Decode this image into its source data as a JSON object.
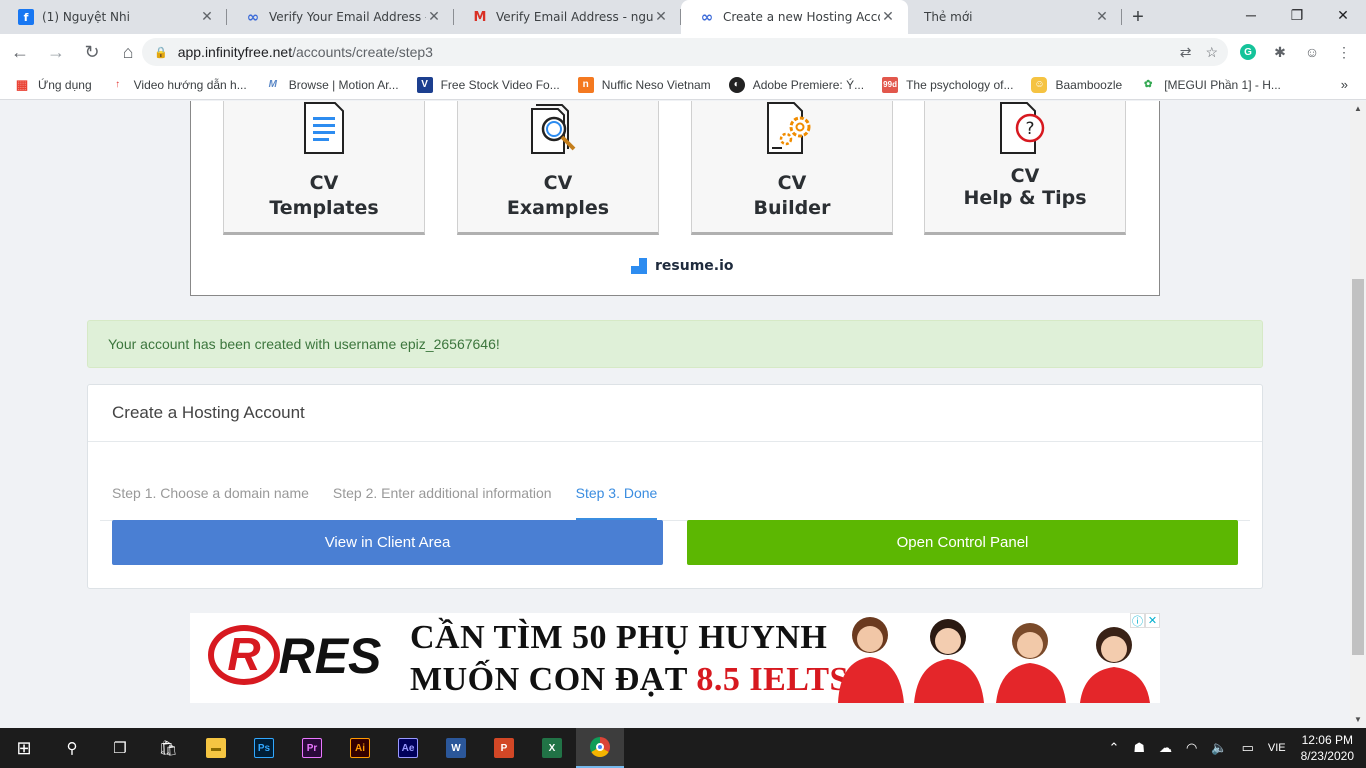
{
  "browser": {
    "tabs": [
      {
        "title": "(1) Nguyệt Nhi",
        "icon": "facebook-icon",
        "active": false
      },
      {
        "title": "Verify Your Email Address - Infi",
        "icon": "infinityfree-icon",
        "active": false
      },
      {
        "title": "Verify Email Address - nguyenn",
        "icon": "gmail-icon",
        "active": false
      },
      {
        "title": "Create a new Hosting Account",
        "icon": "infinityfree-icon",
        "active": true
      },
      {
        "title": "Thẻ mới",
        "icon": "",
        "active": false
      }
    ],
    "address": {
      "host": "app.infinityfree.net",
      "path": "/accounts/create/step3"
    },
    "bookmarks": [
      {
        "label": "Ứng dụng",
        "icon": "apps-grid-icon"
      },
      {
        "label": "Video hướng dẫn h...",
        "icon": "video-icon"
      },
      {
        "label": "Browse | Motion Ar...",
        "icon": "motion-array-icon"
      },
      {
        "label": "Free Stock Video Fo...",
        "icon": "videvo-icon"
      },
      {
        "label": "Nuffic Neso Vietnam",
        "icon": "nuffic-icon"
      },
      {
        "label": "Adobe Premiere: Ý...",
        "icon": "premiere-icon"
      },
      {
        "label": "The psychology of...",
        "icon": "99designs-icon"
      },
      {
        "label": "Baamboozle",
        "icon": "baamboozle-icon"
      },
      {
        "label": "[MEGUI Phần 1] - H...",
        "icon": "megui-icon"
      }
    ]
  },
  "ad_top": {
    "cards": [
      {
        "line1": "CV",
        "line2": "Templates",
        "icon": "document-icon"
      },
      {
        "line1": "CV",
        "line2": "Examples",
        "icon": "magnifier-document-icon"
      },
      {
        "line1": "CV",
        "line2": "Builder",
        "icon": "gear-document-icon"
      },
      {
        "line1": "CV",
        "line2": "Help & Tips",
        "icon": "question-document-icon"
      }
    ],
    "brand": "resume.io"
  },
  "alert": {
    "message": "Your account has been created with username epiz_26567646!"
  },
  "panel": {
    "title": "Create a Hosting Account",
    "steps": [
      {
        "label": "Step 1. Choose a domain name",
        "active": false
      },
      {
        "label": "Step 2. Enter additional information",
        "active": false
      },
      {
        "label": "Step 3. Done",
        "active": true
      }
    ],
    "client_area_label": "View in Client Area",
    "control_panel_label": "Open Control Panel"
  },
  "banner": {
    "logo": "RES",
    "line1": "CẦN TÌM 50 PHỤ HUYNH",
    "line2_prefix": "MUỐN CON ĐẠT ",
    "line2_highlight": "8.5 IELTS"
  },
  "taskbar": {
    "apps": [
      "File Explorer",
      "Ps",
      "Pr",
      "Ai",
      "Ae",
      "Word",
      "PowerPoint",
      "Excel",
      "Chrome"
    ],
    "language": "VIE",
    "time": "12:06 PM",
    "date": "8/23/2020"
  },
  "colors": {
    "accent": "#3b8de0",
    "primary_button": "#4a7fd3",
    "success_button": "#5cb702",
    "alert_bg": "#dff0d8"
  }
}
